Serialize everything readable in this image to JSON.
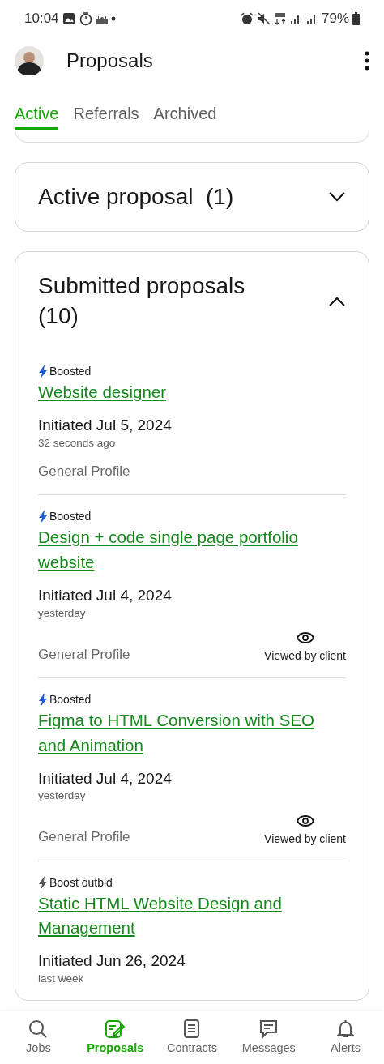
{
  "status_bar": {
    "time": "10:04",
    "battery": "79%"
  },
  "header": {
    "title": "Proposals"
  },
  "tabs": [
    {
      "label": "Active",
      "selected": true
    },
    {
      "label": "Referrals",
      "selected": false
    },
    {
      "label": "Archived",
      "selected": false
    }
  ],
  "sections": [
    {
      "title": "Active proposal  (1)",
      "expanded": false
    },
    {
      "title": "Submitted proposals  (10)",
      "expanded": true,
      "proposals": [
        {
          "boost": "Boosted",
          "kind": "boosted",
          "title": "Website designer",
          "initiated": "Initiated Jul 5, 2024",
          "ago": "32 seconds ago",
          "profile": "General Profile"
        },
        {
          "boost": "Boosted",
          "kind": "boosted",
          "title": "Design + code single page portfolio website",
          "initiated": "Initiated Jul 4, 2024",
          "ago": "yesterday",
          "profile": "General Profile",
          "viewed": "Viewed by client"
        },
        {
          "boost": "Boosted",
          "kind": "boosted",
          "title": "Figma to HTML Conversion with SEO and Animation",
          "initiated": "Initiated Jul 4, 2024",
          "ago": "yesterday",
          "profile": "General Profile",
          "viewed": "Viewed by client"
        },
        {
          "boost": "Boost outbid",
          "kind": "outbid",
          "title": "Static HTML Website Design and Management",
          "initiated": "Initiated Jun 26, 2024",
          "ago": "last week"
        }
      ]
    }
  ],
  "bottom_nav": [
    {
      "label": "Jobs",
      "kind": "search",
      "selected": false
    },
    {
      "label": "Proposals",
      "kind": "edit",
      "selected": true
    },
    {
      "label": "Contracts",
      "kind": "document",
      "selected": false
    },
    {
      "label": "Messages",
      "kind": "chat",
      "selected": false
    },
    {
      "label": "Alerts",
      "kind": "bell",
      "selected": false
    }
  ]
}
